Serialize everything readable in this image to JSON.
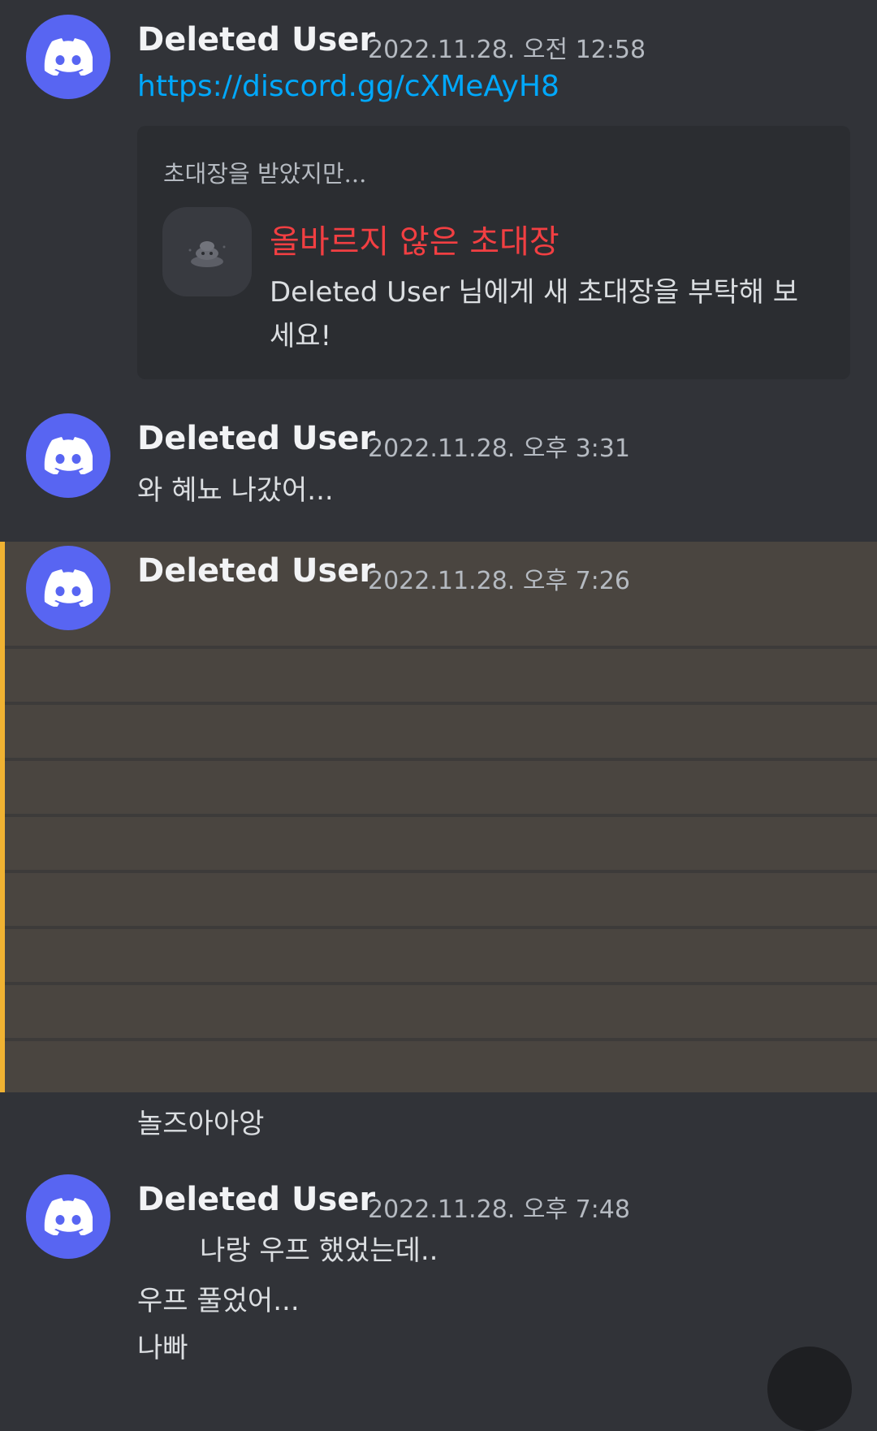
{
  "messages": [
    {
      "author": "Deleted User",
      "timestamp": "2022.11.28. 오전 12:58",
      "link": "https://discord.gg/cXMeAyH8",
      "invite": {
        "heading": "초대장을 받았지만...",
        "title": "올바르지 않은 초대장",
        "description": "Deleted User 님에게 새 초대장을 부탁해 보세요!"
      }
    },
    {
      "author": "Deleted User",
      "timestamp": "2022.11.28. 오후 3:31",
      "text": "와 혜뇨 나갔어..."
    },
    {
      "author": "Deleted User",
      "timestamp": "2022.11.28. 오후 7:26",
      "text_after": "놀즈아아앙"
    },
    {
      "author": "Deleted User",
      "timestamp": "2022.11.28. 오후 7:48",
      "lines": [
        "나랑 우프 했었는데..",
        "우프 풀었어...",
        "나빠"
      ]
    }
  ],
  "colors": {
    "background": "#313338",
    "highlight": "#4a4540",
    "highlight_bar": "#f0b232",
    "avatar": "#5865f2",
    "link": "#00a8fc",
    "error": "#f23f42"
  },
  "icons": {
    "avatar": "discord-logo-icon",
    "invite": "invalid-invite-icon"
  }
}
